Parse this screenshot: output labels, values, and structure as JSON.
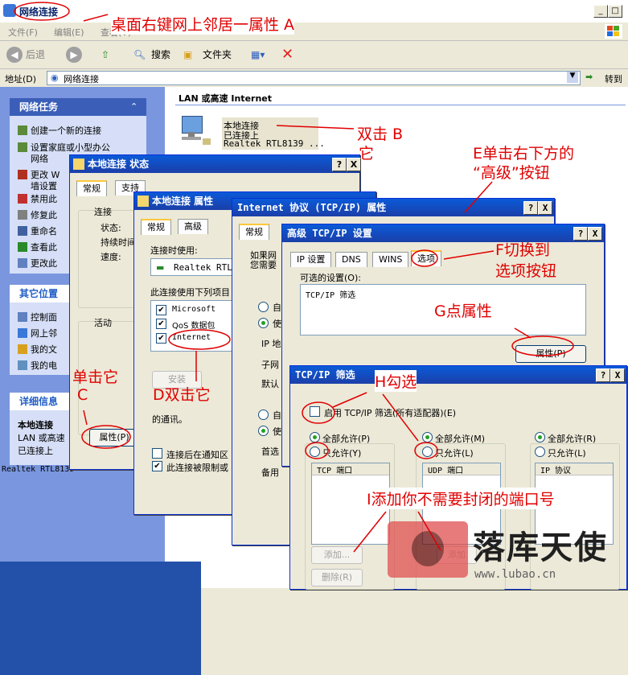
{
  "window": {
    "title": "网络连接",
    "min": "_",
    "max": "□",
    "close": "X"
  },
  "menu": [
    "文件(F)",
    "编辑(E)",
    "查看(V)"
  ],
  "toolbar": {
    "back": "后退",
    "search": "搜索",
    "folders": "文件夹"
  },
  "address": {
    "label": "地址(D)",
    "value": "网络连接",
    "go": "转到"
  },
  "left_pane": {
    "network_tasks": {
      "header": "网络任务",
      "items": [
        "创建一个新的连接",
        "设置家庭或小型办公",
        "网络",
        "更改 W",
        "墙设置",
        "禁用此",
        "修复此",
        "重命名",
        "查看此",
        "更改此"
      ]
    },
    "other_places": {
      "header": "其它位置",
      "items": [
        "控制面",
        "网上邻",
        "我的文",
        "我的电"
      ]
    },
    "details": {
      "header": "详细信息",
      "items": [
        "本地连接",
        "LAN 或高速",
        "已连接上"
      ]
    }
  },
  "main": {
    "section_title": "LAN 或高速 Internet",
    "connection": {
      "name": "本地连接",
      "status": "已连接上",
      "device": "Realtek RTL8139 ..."
    }
  },
  "status_dialog": {
    "title": "本地连接 状态",
    "tabs": [
      "常规",
      "支持"
    ],
    "group_connect": "连接",
    "fields": [
      "状态:",
      "持续时间",
      "速度:"
    ],
    "group_activity": "活动",
    "properties_button": "属性(P)",
    "bottom_text": "Realtek RTL8139"
  },
  "props_dialog": {
    "title": "本地连接 属性",
    "tabs": [
      "常规",
      "高级"
    ],
    "connect_using_label": "连接时使用:",
    "adapter": "Realtek RTL",
    "items_label": "此连接使用下列项目",
    "items": [
      "Microsoft",
      "QoS 数据包",
      "Internet"
    ],
    "install_button": "安装",
    "desc": "的通讯。",
    "notify_label": "连接后在通知区",
    "limited_label": "此连接被限制或"
  },
  "tcpip_dialog": {
    "title": "Internet 协议 (TCP/IP) 属性",
    "tabs": [
      "常规"
    ],
    "desc1": "如果网",
    "desc2": "您需要",
    "radio1": "自",
    "radio2": "使",
    "ip_label": "IP 地",
    "subnet_label": "子网",
    "gateway_label": "默认",
    "radio3": "自",
    "radio4": "使",
    "preferred": "首选",
    "alternate": "备用"
  },
  "advanced_dialog": {
    "title": "高级 TCP/IP 设置",
    "tabs": [
      "IP 设置",
      "DNS",
      "WINS",
      "选项"
    ],
    "optional_label": "可选的设置(O):",
    "list_item": "TCP/IP 筛选",
    "properties_button": "属性(P)"
  },
  "filter_dialog": {
    "title": "TCP/IP 筛选",
    "enable_label": "启用 TCP/IP 筛选(所有适配器)(E)",
    "columns": [
      {
        "allow_all": "全部允许(P)",
        "allow_only": "只允许(Y)",
        "list_header": "TCP 端口"
      },
      {
        "allow_all": "全部允许(M)",
        "allow_only": "只允许(L)",
        "list_header": "UDP 端口"
      },
      {
        "allow_all": "全部允许(R)",
        "allow_only": "只允许(L)",
        "list_header": "IP 协议"
      }
    ],
    "add_button": "添加...",
    "remove_button": "删除(R)",
    "add_button2": "添加"
  },
  "annotations": {
    "a": "桌面右键网上邻居一属性 A",
    "b1": "双击 B",
    "b2": "它",
    "c1": "单击它",
    "c2": "C",
    "d": "D双击它",
    "e1": "E单击右下方的",
    "e2": "“高级”按钮",
    "f1": "F切换到",
    "f2": "选项按钮",
    "g": "G点属性",
    "h": "H勾选",
    "i": "I添加你不需要封闭的端口号"
  },
  "watermark": {
    "brand": "落库天使",
    "url": "www.lubao.cn"
  },
  "colors": {
    "annotation": "#e00000",
    "title_gradient": "#0a5ad8",
    "xp_beige": "#ece9d8",
    "taskbar": "#2350a8"
  }
}
